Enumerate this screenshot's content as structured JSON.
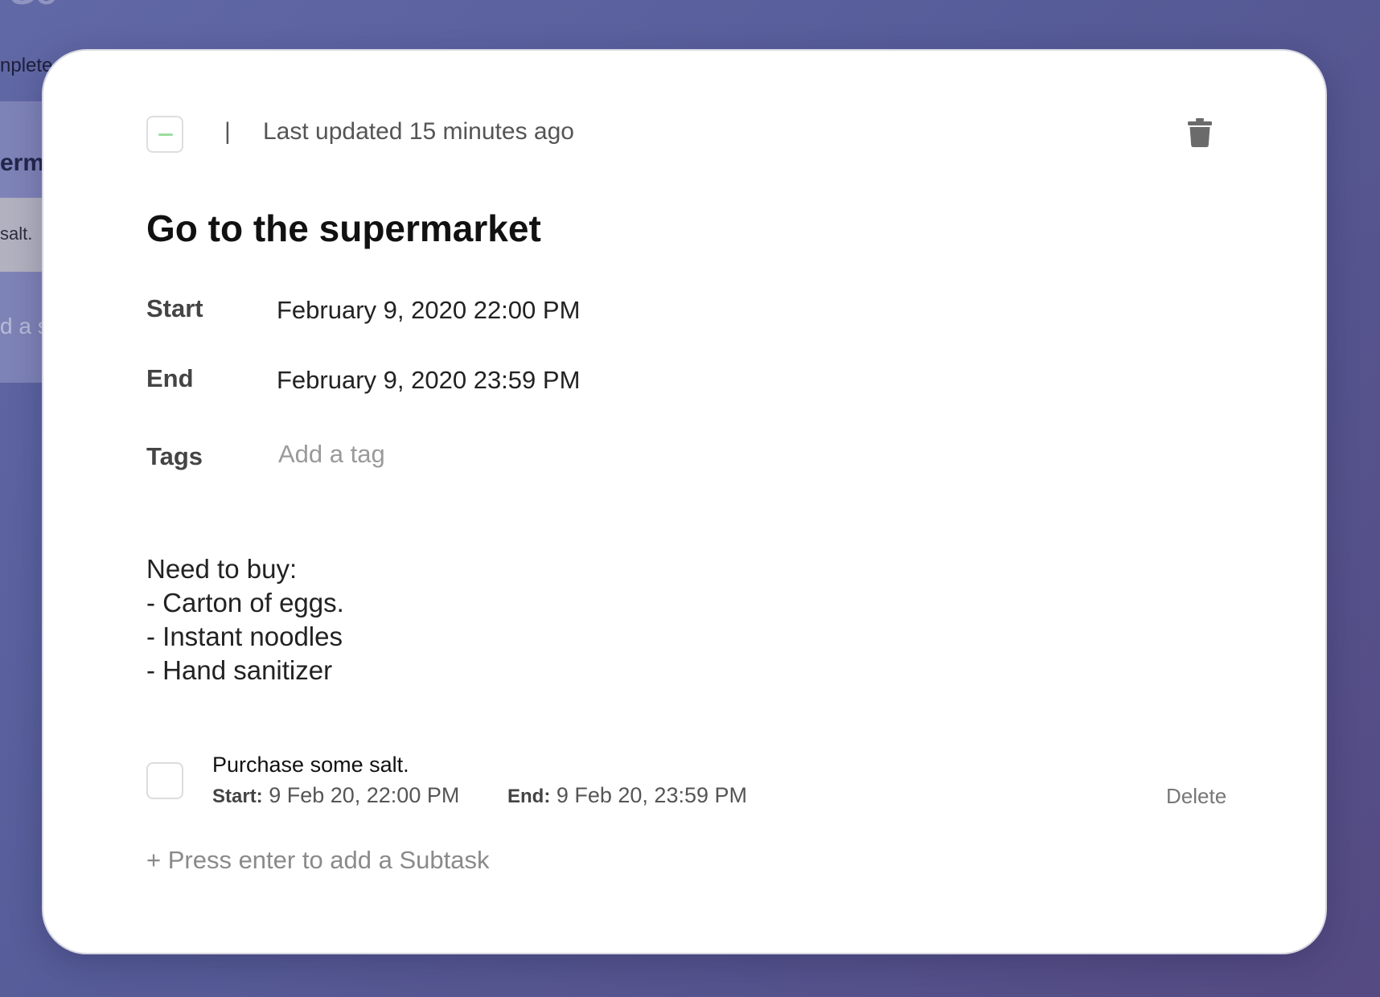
{
  "background": {
    "completed_fragment": "nplete",
    "card_title_fragment": "erma",
    "subtask_fragment": "salt.",
    "add_fragment": "d a s"
  },
  "modal": {
    "separator": "|",
    "last_updated": "Last updated 15 minutes ago",
    "title": "Go to the supermarket",
    "start_label": "Start",
    "start_value": "February 9, 2020 22:00 PM",
    "end_label": "End",
    "end_value": "February 9, 2020 23:59 PM",
    "tags_label": "Tags",
    "tags_placeholder": "Add a tag",
    "notes": [
      "Need to buy:",
      "- Carton of eggs.",
      "- Instant noodles",
      "- Hand sanitizer"
    ],
    "subtask": {
      "title": "Purchase some salt.",
      "start_label": "Start:",
      "start_value": "9 Feb 20, 22:00 PM",
      "end_label": "End:",
      "end_value": "9 Feb 20, 23:59 PM",
      "delete_label": "Delete"
    },
    "add_subtask_placeholder": "+ Press enter to add a Subtask"
  },
  "colors": {
    "background_gradient_start": "#6168a6",
    "background_gradient_end": "#554a82",
    "status_dash": "#9bdca0",
    "trash_icon": "#6b6b6b"
  },
  "icons": {
    "status": "minus-icon",
    "delete": "trash-icon"
  }
}
